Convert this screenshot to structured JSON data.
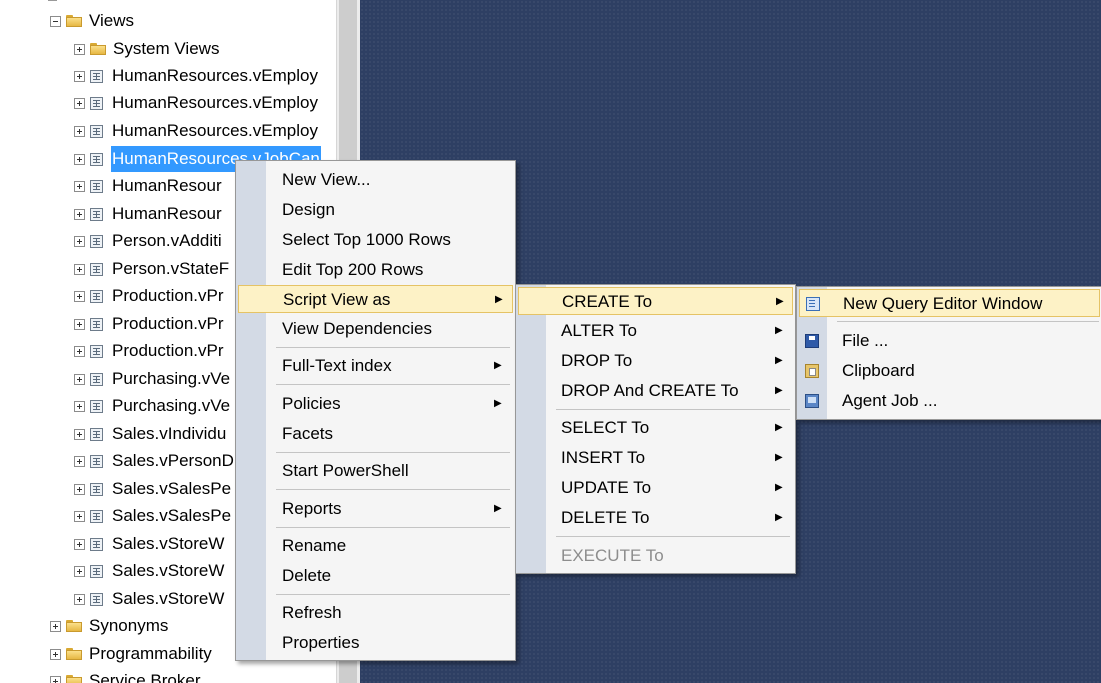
{
  "tree": {
    "views_folder": "Views",
    "items": [
      "System Views",
      "HumanResources.vEmploy",
      "HumanResources.vEmploy",
      "HumanResources.vEmploy",
      "HumanResources.vJobCan",
      "HumanResour",
      "HumanResour",
      "Person.vAdditi",
      "Person.vStateF",
      "Production.vPr",
      "Production.vPr",
      "Production.vPr",
      "Purchasing.vVe",
      "Purchasing.vVe",
      "Sales.vIndividu",
      "Sales.vPersonD",
      "Sales.vSalesPe",
      "Sales.vSalesPe",
      "Sales.vStoreW",
      "Sales.vStoreW",
      "Sales.vStoreW"
    ],
    "siblings": [
      "Synonyms",
      "Programmability",
      "Service Broker"
    ]
  },
  "context_menu": {
    "items": [
      {
        "label": "New View..."
      },
      {
        "label": "Design"
      },
      {
        "label": "Select Top 1000 Rows"
      },
      {
        "label": "Edit Top 200 Rows"
      },
      {
        "label": "Script View as",
        "submenu": true,
        "highlighted": true
      },
      {
        "label": "View Dependencies"
      },
      {
        "label": "Full-Text index",
        "submenu": true
      },
      {
        "label": "Policies",
        "submenu": true
      },
      {
        "label": "Facets"
      },
      {
        "label": "Start PowerShell"
      },
      {
        "label": "Reports",
        "submenu": true
      },
      {
        "label": "Rename"
      },
      {
        "label": "Delete"
      },
      {
        "label": "Refresh"
      },
      {
        "label": "Properties"
      }
    ]
  },
  "script_menu": {
    "items": [
      {
        "label": "CREATE To",
        "submenu": true,
        "highlighted": true
      },
      {
        "label": "ALTER To",
        "submenu": true
      },
      {
        "label": "DROP To",
        "submenu": true
      },
      {
        "label": "DROP And CREATE To",
        "submenu": true
      },
      {
        "label": "SELECT To",
        "submenu": true
      },
      {
        "label": "INSERT To",
        "submenu": true
      },
      {
        "label": "UPDATE To",
        "submenu": true
      },
      {
        "label": "DELETE To",
        "submenu": true
      },
      {
        "label": "EXECUTE To",
        "disabled": true
      }
    ]
  },
  "create_menu": {
    "items": [
      {
        "label": "New Query Editor Window",
        "icon": "query-window-icon",
        "highlighted": true
      },
      {
        "label": "File ...",
        "icon": "save-file-icon"
      },
      {
        "label": "Clipboard",
        "icon": "clipboard-icon"
      },
      {
        "label": "Agent Job ...",
        "icon": "agent-job-icon"
      }
    ]
  },
  "colors": {
    "doc_background": "#2e3f63",
    "selection": "#3399ff",
    "menu_highlight": "#fdf2c6",
    "menu_gutter": "#d3dae5"
  }
}
